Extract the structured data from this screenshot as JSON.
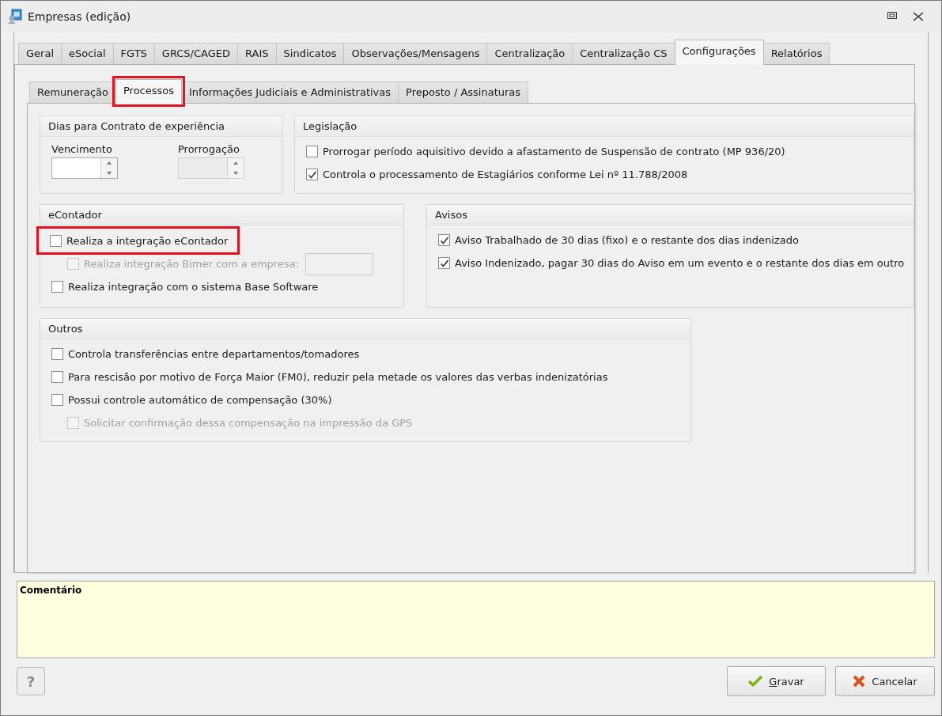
{
  "window": {
    "title": "Empresas (edição)"
  },
  "tabs": [
    {
      "label": "Geral",
      "selected": false
    },
    {
      "label": "eSocial",
      "selected": false
    },
    {
      "label": "FGTS",
      "selected": false
    },
    {
      "label": "GRCS/CAGED",
      "selected": false
    },
    {
      "label": "RAIS",
      "selected": false
    },
    {
      "label": "Sindicatos",
      "selected": false
    },
    {
      "label": "Observações/Mensagens",
      "selected": false
    },
    {
      "label": "Centralização",
      "selected": false
    },
    {
      "label": "Centralização CS",
      "selected": false
    },
    {
      "label": "Configurações",
      "selected": true
    },
    {
      "label": "Relatórios",
      "selected": false
    }
  ],
  "subtabs": [
    {
      "label": "Remuneração",
      "selected": false,
      "highlighted": false
    },
    {
      "label": "Processos",
      "selected": true,
      "highlighted": true
    },
    {
      "label": "Informações Judiciais e Administrativas",
      "selected": false,
      "highlighted": false
    },
    {
      "label": "Preposto / Assinaturas",
      "selected": false,
      "highlighted": false
    }
  ],
  "groups": [
    {
      "title": "Dias para Contrato de experiência",
      "kind": "spinners",
      "fields": [
        {
          "label": "Vencimento",
          "disabled": false
        },
        {
          "label": "Prorrogação",
          "disabled": true
        }
      ]
    },
    {
      "title": "Legislação",
      "kind": "checks",
      "items": [
        {
          "label": "Prorrogar período aquisitivo devido a afastamento de Suspensão de contrato (MP 936/20)",
          "checked": false,
          "disabled": false,
          "indented": false,
          "highlighted": false,
          "kind": "checkbox"
        },
        {
          "label": "Controla o processamento de Estagiários conforme Lei nº 11.788/2008",
          "checked": true,
          "disabled": false,
          "indented": false,
          "highlighted": false,
          "kind": "checkbox"
        }
      ]
    },
    {
      "title": "eContador",
      "kind": "checks",
      "items": [
        {
          "label": "Realiza a integração eContador",
          "checked": false,
          "disabled": false,
          "indented": false,
          "highlighted": true,
          "kind": "checkbox"
        },
        {
          "label": "Realiza integração Bimer com a empresa:",
          "checked": false,
          "disabled": true,
          "indented": true,
          "highlighted": false,
          "kind": "checkbox_field"
        },
        {
          "label": "Realiza integração com o sistema Base Software",
          "checked": false,
          "disabled": false,
          "indented": false,
          "highlighted": false,
          "kind": "checkbox"
        }
      ]
    },
    {
      "title": "Avisos",
      "kind": "checks",
      "items": [
        {
          "label": "Aviso Trabalhado de 30 dias (fixo) e o restante dos dias indenizado",
          "checked": true,
          "disabled": false,
          "indented": false,
          "highlighted": false,
          "kind": "checkbox"
        },
        {
          "label": "Aviso Indenizado, pagar 30 dias do Aviso em um evento e o restante dos dias em outro",
          "checked": true,
          "disabled": false,
          "indented": false,
          "highlighted": false,
          "kind": "checkbox"
        }
      ]
    },
    {
      "title": "Outros",
      "kind": "checks",
      "items": [
        {
          "label": "Controla transferências entre departamentos/tomadores",
          "checked": false,
          "disabled": false,
          "indented": false,
          "highlighted": false,
          "kind": "checkbox"
        },
        {
          "label": "Para rescisão por motivo de Força Maior (FM0), reduzir pela metade os valores das verbas indenizatórias",
          "checked": false,
          "disabled": false,
          "indented": false,
          "highlighted": false,
          "kind": "checkbox"
        },
        {
          "label": "Possui controle automático de compensação (30%)",
          "checked": false,
          "disabled": false,
          "indented": false,
          "highlighted": false,
          "kind": "checkbox"
        },
        {
          "label": "Solicitar confirmação dessa compensação na impressão da GPS",
          "checked": false,
          "disabled": true,
          "indented": true,
          "highlighted": false,
          "kind": "checkbox"
        }
      ]
    }
  ],
  "comment": {
    "label": "Comentário"
  },
  "help_button": {
    "label": "?"
  },
  "buttons": [
    {
      "label": "Gravar",
      "kind": "confirm",
      "mnemonic": true
    },
    {
      "label": "Cancelar",
      "kind": "cancel",
      "mnemonic": false
    }
  ]
}
